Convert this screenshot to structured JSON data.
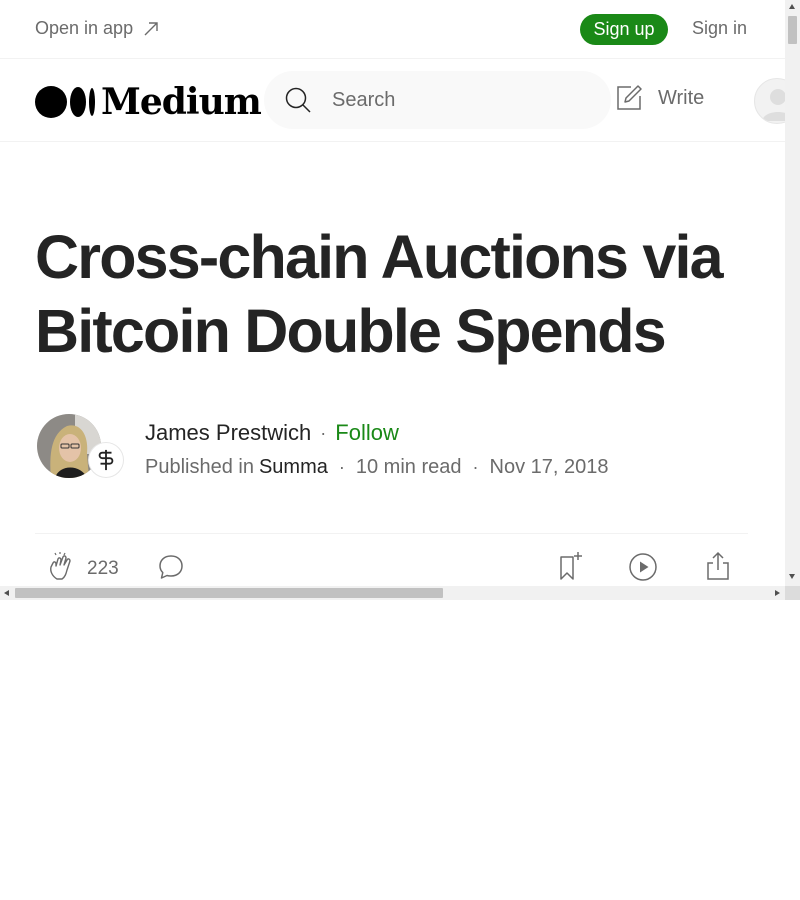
{
  "banner": {
    "open_in_app": "Open in app",
    "sign_up": "Sign up",
    "sign_in": "Sign in"
  },
  "header": {
    "logo_text": "Medium",
    "search_placeholder": "Search",
    "write": "Write"
  },
  "article": {
    "title": "Cross-chain Auctions via Bitcoin Double Spends",
    "author": "James Prestwich",
    "follow": "Follow",
    "published_in_prefix": "Published in",
    "publication": "Summa",
    "read_time": "10 min read",
    "date": "Nov 17, 2018",
    "separator": "·"
  },
  "actions": {
    "clap_count": "223"
  },
  "colors": {
    "accent_green": "#1a8917",
    "text_primary": "#242424",
    "text_secondary": "#6b6b6b"
  },
  "icons": [
    "external-arrow-icon",
    "search-icon",
    "write-icon",
    "user-icon",
    "publication-logo-icon",
    "clap-icon",
    "comment-icon",
    "bookmark-icon",
    "play-icon",
    "share-icon"
  ]
}
